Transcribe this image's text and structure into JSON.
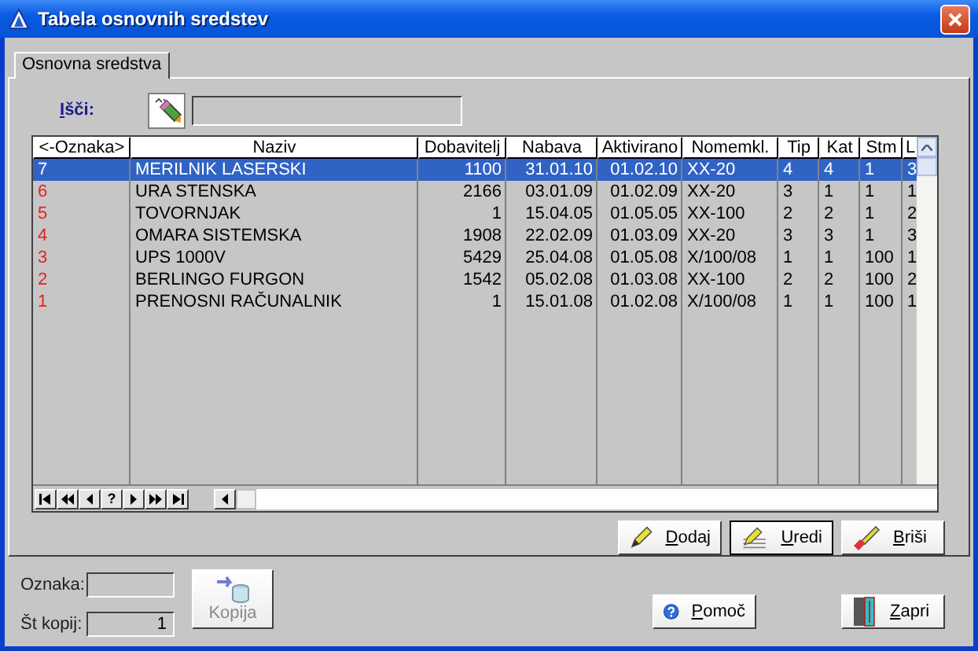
{
  "window": {
    "title": "Tabela osnovnih sredstev"
  },
  "tabs": [
    {
      "label": "Osnovna sredstva",
      "selected": true
    }
  ],
  "search": {
    "hotkey": "I",
    "label_rest": "šči:"
  },
  "table": {
    "columns": [
      "<-Oznaka>",
      "Naziv",
      "Dobavitelj",
      "Nabava",
      "Aktivirano",
      "Nomemkl.",
      "Tip",
      "Kat",
      "Stm",
      "L"
    ],
    "rows": [
      {
        "selected": true,
        "cells": [
          "7",
          "MERILNIK LASERSKI",
          "1100",
          "31.01.10",
          "01.02.10",
          "XX-20",
          "4",
          "4",
          "1",
          "3"
        ]
      },
      {
        "selected": false,
        "cells": [
          "6",
          "URA STENSKA",
          "2166",
          "03.01.09",
          "01.02.09",
          "XX-20",
          "3",
          "1",
          "1",
          "1"
        ]
      },
      {
        "selected": false,
        "cells": [
          "5",
          "TOVORNJAK",
          "1",
          "15.04.05",
          "01.05.05",
          "XX-100",
          "2",
          "2",
          "1",
          "2"
        ]
      },
      {
        "selected": false,
        "cells": [
          "4",
          "OMARA SISTEMSKA",
          "1908",
          "22.02.09",
          "01.03.09",
          "XX-20",
          "3",
          "3",
          "1",
          "3"
        ]
      },
      {
        "selected": false,
        "cells": [
          "3",
          "UPS 1000V",
          "5429",
          "25.04.08",
          "01.05.08",
          "X/100/08",
          "1",
          "1",
          "100",
          "1"
        ]
      },
      {
        "selected": false,
        "cells": [
          "2",
          "BERLINGO FURGON",
          "1542",
          "05.02.08",
          "01.03.08",
          "XX-100",
          "2",
          "2",
          "100",
          "2"
        ]
      },
      {
        "selected": false,
        "cells": [
          "1",
          "PRENOSNI RAČUNALNIK",
          "1",
          "15.01.08",
          "01.02.08",
          "X/100/08",
          "1",
          "1",
          "100",
          "1"
        ]
      }
    ]
  },
  "navigator": [
    {
      "kind": "first"
    },
    {
      "kind": "prev-page"
    },
    {
      "kind": "prev"
    },
    {
      "kind": "refresh",
      "label": "?"
    },
    {
      "kind": "next"
    },
    {
      "kind": "next-page"
    },
    {
      "kind": "last"
    }
  ],
  "actions": [
    {
      "kind": "add",
      "hotkey": "D",
      "label_rest": "odaj",
      "default": false
    },
    {
      "kind": "edit",
      "hotkey": "U",
      "label_rest": "redi",
      "default": true
    },
    {
      "kind": "delete",
      "hotkey": "B",
      "label_rest": "riši",
      "default": false
    }
  ],
  "copy_panel": {
    "oznaka_label": "Oznaka:",
    "copies_label": "Št kopij:",
    "copies_value": "1",
    "copy_button": {
      "label": "Kopija",
      "disabled": true
    }
  },
  "footer_buttons": [
    {
      "kind": "help",
      "hotkey": "P",
      "label_rest": "omoč"
    },
    {
      "kind": "close",
      "hotkey": "Z",
      "label_rest": "apri"
    }
  ]
}
